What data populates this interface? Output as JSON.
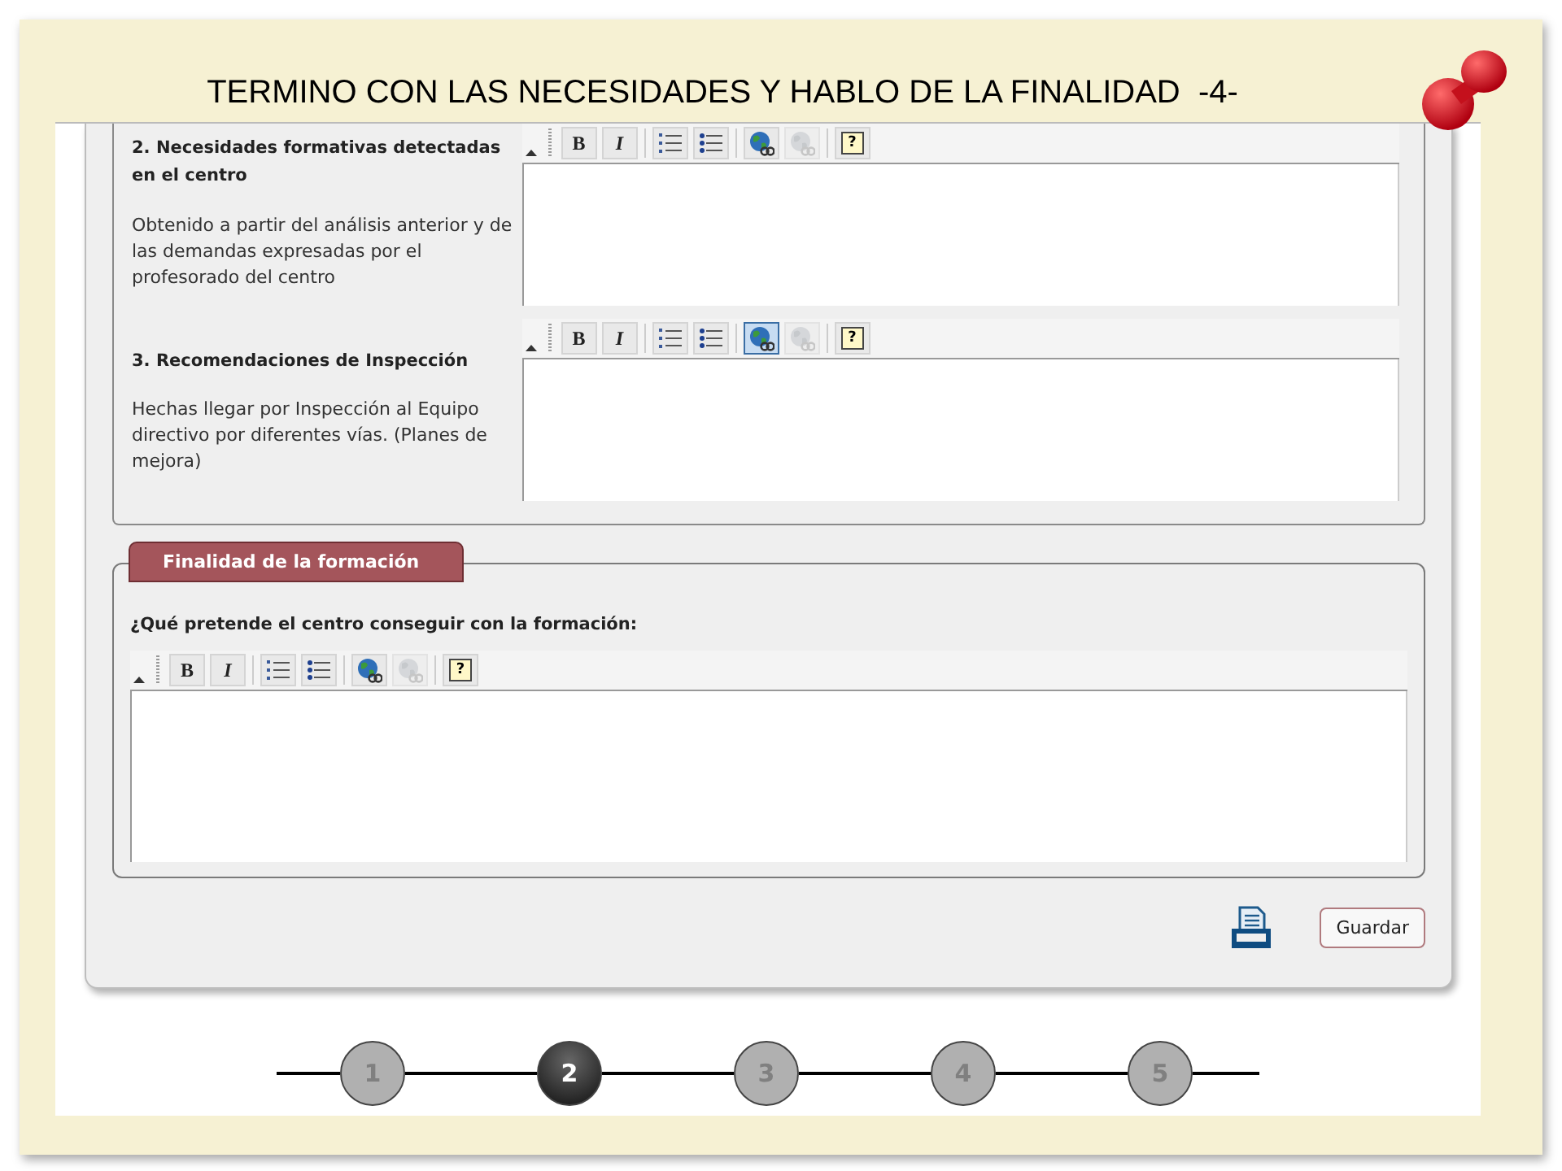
{
  "slide": {
    "title": "TERMINO CON LAS NECESIDADES Y HABLO DE LA FINALIDAD  -4-"
  },
  "needs_section": {
    "items": [
      {
        "heading": "2. Necesidades formativas detectadas en el centro",
        "description": "Obtenido a partir del análisis anterior y de las demandas expresadas por el profesorado del centro",
        "editor": {
          "toolbar": [
            {
              "kind": "bold",
              "label": "B",
              "selected": false,
              "disabled": false
            },
            {
              "kind": "italic",
              "label": "I",
              "selected": false,
              "disabled": false
            },
            {
              "kind": "ordered-list",
              "selected": false,
              "disabled": false
            },
            {
              "kind": "bullet-list",
              "selected": false,
              "disabled": false
            },
            {
              "kind": "link",
              "selected": false,
              "disabled": false
            },
            {
              "kind": "unlink",
              "selected": false,
              "disabled": true
            },
            {
              "kind": "help",
              "label": "?",
              "selected": false,
              "disabled": false
            }
          ]
        }
      },
      {
        "heading": "3. Recomendaciones de Inspección",
        "description": "Hechas llegar por Inspección al Equipo directivo por diferentes vías. (Planes de mejora)",
        "editor": {
          "toolbar": [
            {
              "kind": "bold",
              "label": "B",
              "selected": false,
              "disabled": false
            },
            {
              "kind": "italic",
              "label": "I",
              "selected": false,
              "disabled": false
            },
            {
              "kind": "ordered-list",
              "selected": false,
              "disabled": false
            },
            {
              "kind": "bullet-list",
              "selected": false,
              "disabled": false
            },
            {
              "kind": "link",
              "selected": true,
              "disabled": false
            },
            {
              "kind": "unlink",
              "selected": false,
              "disabled": true
            },
            {
              "kind": "help",
              "label": "?",
              "selected": false,
              "disabled": false
            }
          ]
        }
      }
    ]
  },
  "purpose_section": {
    "legend": "Finalidad de la formación",
    "question": "¿Qué pretende el centro conseguir con la formación:",
    "editor": {
      "toolbar": [
        {
          "kind": "bold",
          "label": "B",
          "selected": false,
          "disabled": false
        },
        {
          "kind": "italic",
          "label": "I",
          "selected": false,
          "disabled": false
        },
        {
          "kind": "ordered-list",
          "selected": false,
          "disabled": false
        },
        {
          "kind": "bullet-list",
          "selected": false,
          "disabled": false
        },
        {
          "kind": "link",
          "selected": false,
          "disabled": false
        },
        {
          "kind": "unlink",
          "selected": false,
          "disabled": true
        },
        {
          "kind": "help",
          "label": "?",
          "selected": false,
          "disabled": false
        }
      ]
    }
  },
  "actions": {
    "save": "Guardar"
  },
  "steps": [
    {
      "label": "1",
      "selected": false
    },
    {
      "label": "2",
      "selected": true
    },
    {
      "label": "3",
      "selected": false
    },
    {
      "label": "4",
      "selected": false
    },
    {
      "label": "5",
      "selected": false
    }
  ]
}
